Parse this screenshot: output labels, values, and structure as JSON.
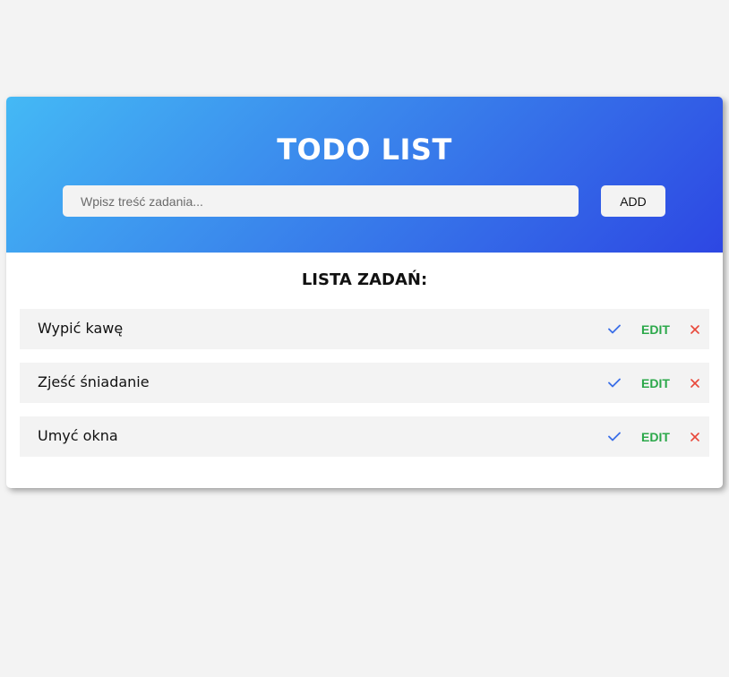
{
  "header": {
    "title": "TODO LIST",
    "input_placeholder": "Wpisz treść zadania...",
    "input_value": "",
    "add_label": "ADD"
  },
  "list": {
    "heading": "LISTA ZADAŃ:",
    "edit_label": "EDIT",
    "items": [
      {
        "text": "Wypić kawę"
      },
      {
        "text": "Zjeść śniadanie"
      },
      {
        "text": "Umyć okna"
      }
    ]
  },
  "icons": {
    "complete": "check-icon",
    "delete": "close-icon"
  },
  "colors": {
    "gradient_start": "#44b9f5",
    "gradient_end": "#2d47e3",
    "complete": "#3a6ee8",
    "edit": "#2ba84a",
    "delete": "#e8483a"
  }
}
